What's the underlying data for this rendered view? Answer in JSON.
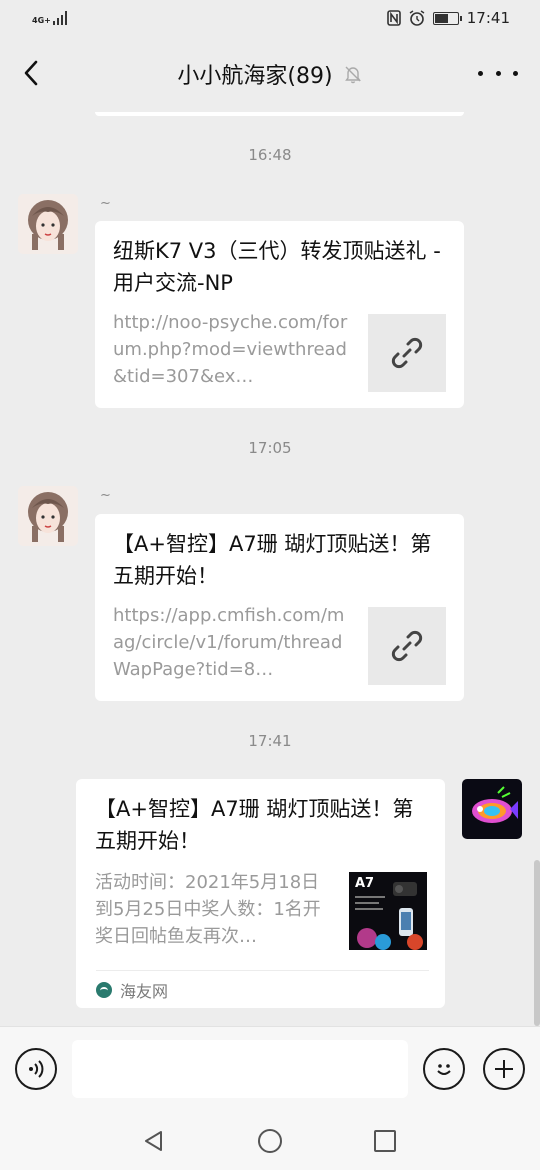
{
  "status_bar": {
    "network": "4G+",
    "time": "17:41",
    "battery_level": 0.6
  },
  "header": {
    "title": "小小航海家(89)",
    "back_icon": "chevron-left-icon",
    "mute_icon": "bell-off-icon",
    "more_icon": "more-dots-icon"
  },
  "messages": [
    {
      "timestamp": "16:48",
      "sender": "~",
      "title": "纽斯K7 V3（三代）转发顶贴送礼 - 用户交流-NP",
      "desc": "http://noo-psyche.com/forum.php?mod=viewthread&tid=307&ex…",
      "thumb_icon": "link-icon"
    },
    {
      "timestamp": "17:05",
      "sender": "~",
      "title": "【A+智控】A7珊 瑚灯顶贴送！第五期开始！",
      "desc": "https://app.cmfish.com/mag/circle/v1/forum/threadWapPage?tid=8…",
      "thumb_icon": "link-icon"
    },
    {
      "timestamp": "17:41",
      "title": "【A+智控】A7珊 瑚灯顶贴送！第五期开始！",
      "desc": "活动时间：2021年5月18日到5月25日中奖人数：1名开奖日回帖鱼友再次…",
      "thumb_label": "A7",
      "source": "海友网"
    }
  ],
  "input_bar": {
    "voice_icon": "voice-icon",
    "emoji_icon": "emoji-icon",
    "plus_icon": "plus-icon",
    "placeholder": ""
  },
  "nav_bar": {
    "back_icon": "nav-back-icon",
    "home_icon": "nav-home-icon",
    "recents_icon": "nav-recents-icon"
  }
}
